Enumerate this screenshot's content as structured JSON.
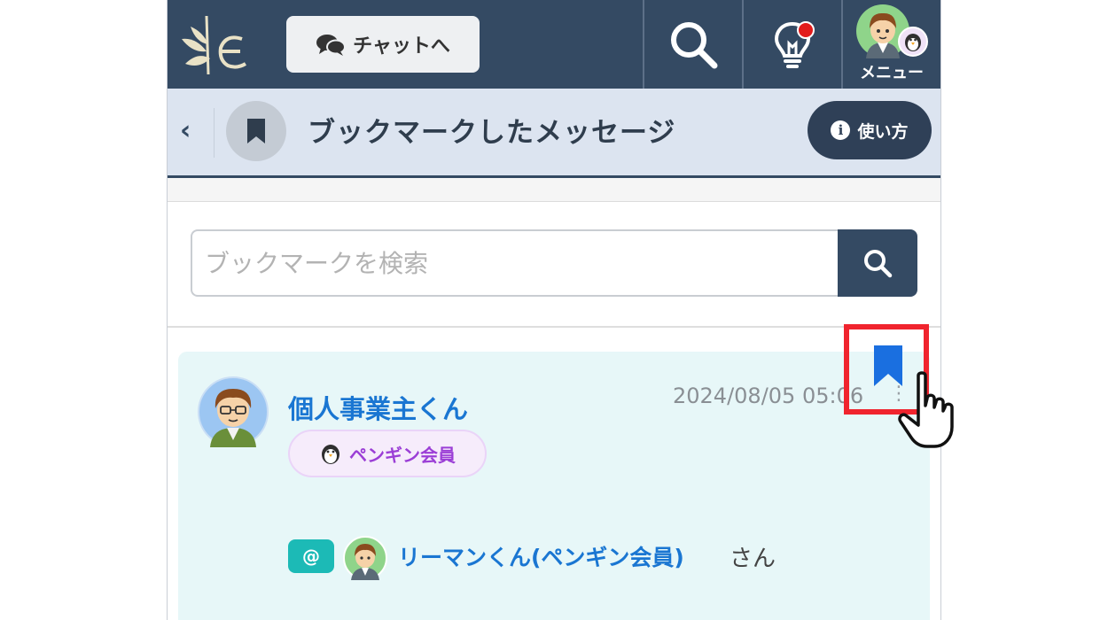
{
  "topnav": {
    "chat_button_label": "チャットへ",
    "menu_label": "メニュー"
  },
  "titlebar": {
    "back": "‹",
    "title": "ブックマークしたメッセージ",
    "howto_label": "使い方",
    "info_glyph": "i"
  },
  "search": {
    "placeholder": "ブックマークを検索",
    "value": ""
  },
  "message": {
    "author": "個人事業主くん",
    "badge": "ペンギン会員",
    "timestamp": "2024/08/05 05:06",
    "mention_at": "@",
    "mention_name": "リーマンくん(ペンギン会員)",
    "mention_suffix": "さん"
  },
  "colors": {
    "nav": "#344a63",
    "titlebar": "#dce4f0",
    "card": "#e7f7f8",
    "link": "#1a76d2",
    "badge_text": "#9b3ed6",
    "highlight": "#f0242e",
    "bookmark": "#1a6fe0"
  },
  "icons": [
    "logo-icon",
    "chat-icon",
    "search-icon",
    "lightbulb-icon",
    "avatar-icon",
    "penguin-icon",
    "bookmark-icon",
    "info-icon",
    "hand-pointer-icon"
  ]
}
